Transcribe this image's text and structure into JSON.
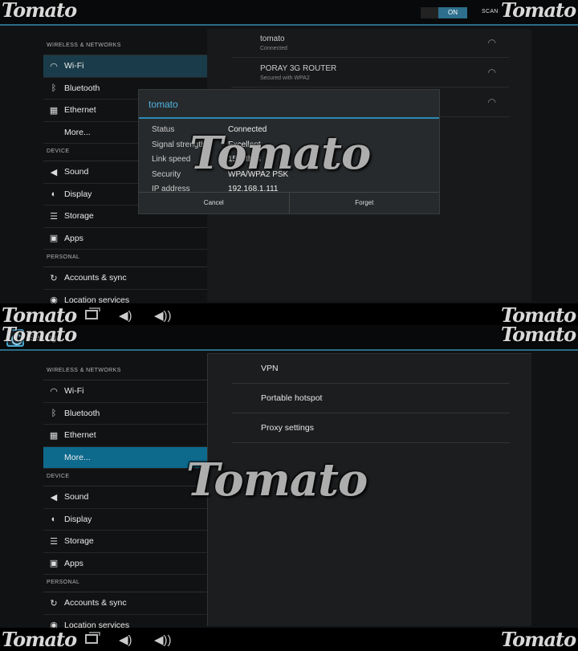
{
  "watermark": "Tomato",
  "top": {
    "actionbar": {
      "toggle": "ON",
      "scan": "SCAN"
    },
    "sidebar": {
      "sections": [
        "WIRELESS & NETWORKS",
        "DEVICE",
        "PERSONAL"
      ],
      "items": [
        {
          "label": "Wi-Fi",
          "icon": "wifi-icon"
        },
        {
          "label": "Bluetooth",
          "icon": "bluetooth-icon"
        },
        {
          "label": "Ethernet",
          "icon": "ethernet-icon"
        },
        {
          "label": "More...",
          "icon": ""
        },
        {
          "label": "Sound",
          "icon": "sound-icon"
        },
        {
          "label": "Display",
          "icon": "display-icon"
        },
        {
          "label": "Storage",
          "icon": "storage-icon"
        },
        {
          "label": "Apps",
          "icon": "apps-icon"
        },
        {
          "label": "Accounts & sync",
          "icon": "sync-icon"
        },
        {
          "label": "Location services",
          "icon": "location-icon"
        }
      ]
    },
    "networks": [
      {
        "name": "tomato",
        "status": "Connected"
      },
      {
        "name": "PORAY 3G ROUTER",
        "status": "Secured with WPA2"
      },
      {
        "name": "",
        "status": ""
      }
    ],
    "dialog": {
      "title": "tomato",
      "rows": [
        {
          "key": "Status",
          "value": "Connected"
        },
        {
          "key": "Signal strength",
          "value": "Excellent"
        },
        {
          "key": "Link speed",
          "value": "150Mbps"
        },
        {
          "key": "Security",
          "value": "WPA/WPA2 PSK"
        },
        {
          "key": "IP address",
          "value": "192.168.1.111"
        }
      ],
      "cancel": "Cancel",
      "forget": "Forget"
    }
  },
  "bottom": {
    "actionbar": {
      "title": "Settings"
    },
    "sidebar": {
      "sections": [
        "WIRELESS & NETWORKS",
        "DEVICE",
        "PERSONAL"
      ],
      "items": [
        {
          "label": "Wi-Fi"
        },
        {
          "label": "Bluetooth"
        },
        {
          "label": "Ethernet"
        },
        {
          "label": "More..."
        },
        {
          "label": "Sound"
        },
        {
          "label": "Display"
        },
        {
          "label": "Storage"
        },
        {
          "label": "Apps"
        },
        {
          "label": "Accounts & sync"
        },
        {
          "label": "Location services"
        }
      ]
    },
    "options": [
      "VPN",
      "Portable hotspot",
      "Proxy settings"
    ]
  },
  "colors": {
    "accent": "#2b8ab5",
    "selected": "#0d6a8d",
    "clock": "#43b5e6"
  }
}
